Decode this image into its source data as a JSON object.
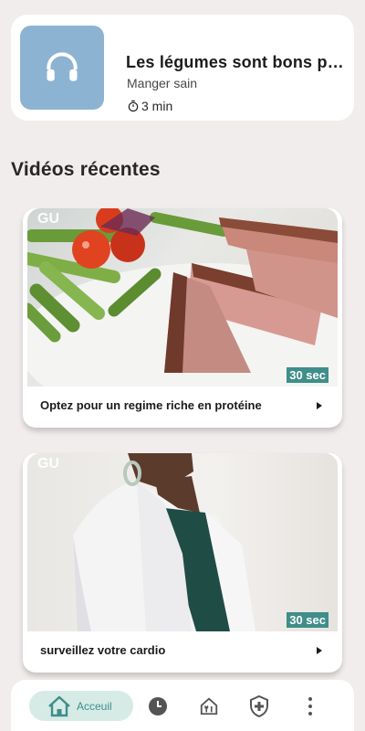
{
  "audio_card": {
    "title": "Les légumes sont bons po...",
    "subtitle": "Manger sain",
    "duration": "3 min",
    "icon": "headphones-icon",
    "thumb_color": "#8db3d2"
  },
  "section": {
    "title": "Vidéos récentes"
  },
  "videos": [
    {
      "caption": "Optez pour un regime riche en protéine",
      "duration": "30 sec",
      "logo": "GU"
    },
    {
      "caption": "surveillez votre cardio",
      "duration": "30 sec",
      "logo": "GU"
    }
  ],
  "nav": {
    "home_label": "Acceuil",
    "items": [
      "home-icon",
      "history-icon",
      "restaurant-icon",
      "health-shield-icon",
      "more-vert-icon"
    ],
    "accent": "#3f8e8a"
  }
}
